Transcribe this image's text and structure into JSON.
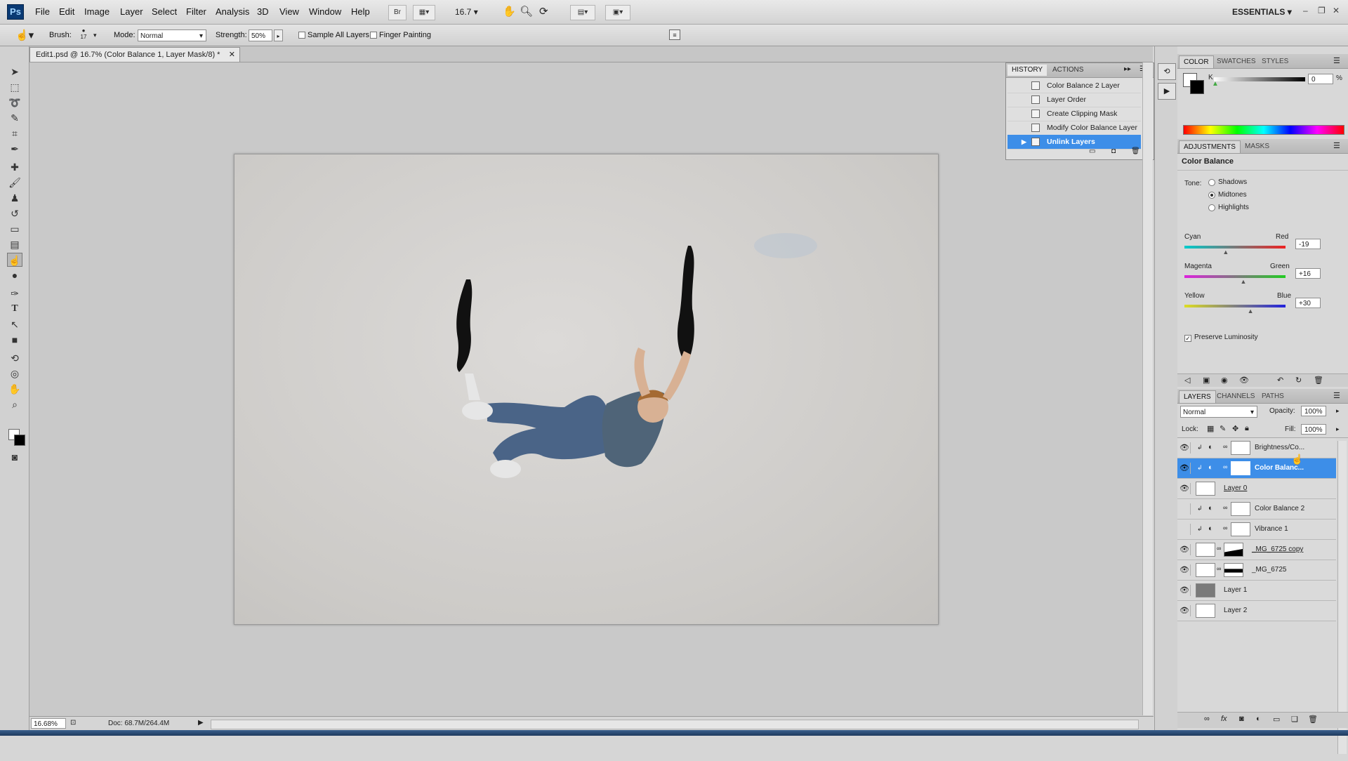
{
  "app": {
    "logo": "Ps"
  },
  "menu": [
    "File",
    "Edit",
    "Image",
    "Layer",
    "Select",
    "Filter",
    "Analysis",
    "3D",
    "View",
    "Window",
    "Help"
  ],
  "appbar": {
    "bridge_label": "Br",
    "zoom": "16.7",
    "workspace": "ESSENTIALS"
  },
  "options": {
    "brush_label": "Brush:",
    "brush_size": "17",
    "mode_label": "Mode:",
    "mode_value": "Normal",
    "strength_label": "Strength:",
    "strength_value": "50%",
    "sample_all_layers": "Sample All Layers",
    "finger_painting": "Finger Painting"
  },
  "document": {
    "tab_title": "Edit1.psd @ 16.7% (Color Balance 1, Layer Mask/8) *"
  },
  "status": {
    "zoom": "16.68%",
    "doc_size": "Doc: 68.7M/264.4M"
  },
  "history": {
    "tabs": [
      "HISTORY",
      "ACTIONS"
    ],
    "items": [
      "Color Balance 2 Layer",
      "Layer Order",
      "Create Clipping Mask",
      "Modify Color Balance Layer",
      "Unlink Layers"
    ]
  },
  "color_panel": {
    "tabs": [
      "COLOR",
      "SWATCHES",
      "STYLES"
    ],
    "channel": "K",
    "value": "0",
    "unit": "%"
  },
  "adjustments": {
    "tabs": [
      "ADJUSTMENTS",
      "MASKS"
    ],
    "title": "Color Balance",
    "tone_label": "Tone:",
    "tones": [
      "Shadows",
      "Midtones",
      "Highlights"
    ],
    "selected_tone": "Midtones",
    "sliders": [
      {
        "left": "Cyan",
        "right": "Red",
        "value": "-19",
        "level": -19
      },
      {
        "left": "Magenta",
        "right": "Green",
        "value": "+16",
        "level": 16
      },
      {
        "left": "Yellow",
        "right": "Blue",
        "value": "+30",
        "level": 30
      }
    ],
    "preserve_luminosity": "Preserve Luminosity"
  },
  "layers_panel": {
    "tabs": [
      "LAYERS",
      "CHANNELS",
      "PATHS"
    ],
    "blend_mode": "Normal",
    "opacity_label": "Opacity:",
    "opacity": "100%",
    "lock_label": "Lock:",
    "fill_label": "Fill:",
    "fill": "100%",
    "layers": [
      {
        "name": "Brightness/Co...",
        "visible": true,
        "type": "adjustment",
        "selected": false
      },
      {
        "name": "Color Balanc...",
        "visible": true,
        "type": "adjustment",
        "selected": true
      },
      {
        "name": "Layer 0",
        "visible": true,
        "type": "pixel",
        "selected": false
      },
      {
        "name": "Color Balance 2",
        "visible": false,
        "type": "adjustment",
        "selected": false
      },
      {
        "name": "Vibrance 1",
        "visible": false,
        "type": "adjustment",
        "selected": false
      },
      {
        "name": "_MG_6725 copy",
        "visible": true,
        "type": "masked",
        "selected": false
      },
      {
        "name": "_MG_6725",
        "visible": true,
        "type": "masked",
        "selected": false
      },
      {
        "name": "Layer 1",
        "visible": true,
        "type": "gray",
        "selected": false
      },
      {
        "name": "Layer 2",
        "visible": true,
        "type": "white",
        "selected": false
      }
    ]
  },
  "colors": {
    "accent": "#3d8ee8",
    "ps_blue": "#0a3a74"
  }
}
